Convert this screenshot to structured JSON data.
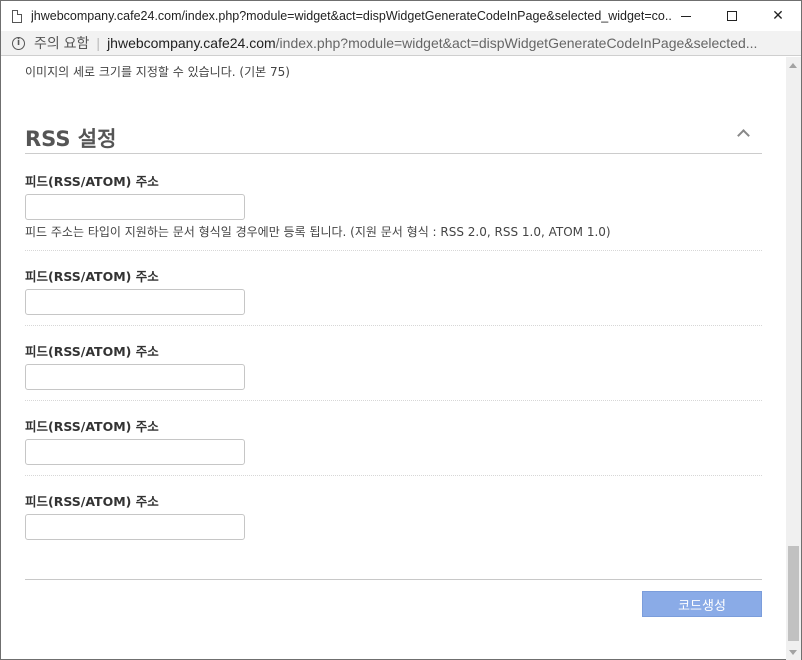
{
  "window": {
    "title": "jhwebcompany.cafe24.com/index.php?module=widget&act=dispWidgetGenerateCodeInPage&selected_widget=co...",
    "controls": {
      "minimize": "",
      "maximize": "",
      "close": "✕"
    }
  },
  "addressbar": {
    "info": "i",
    "warning": "주의 요함",
    "separator": "|",
    "host": "jhwebcompany.cafe24.com",
    "path": "/index.php?module=widget&act=dispWidgetGenerateCodeInPage&selected..."
  },
  "content": {
    "top_hint": "이미지의 세로 크기를 지정할 수 있습니다. (기본 75)",
    "section_title": "RSS 설정",
    "fields": [
      {
        "label": "피드(RSS/ATOM) 주소",
        "value": "",
        "help": "피드 주소는 타입이 지원하는 문서 형식일 경우에만 등록 됩니다. (지원 문서 형식 : RSS 2.0, RSS 1.0, ATOM 1.0)"
      },
      {
        "label": "피드(RSS/ATOM) 주소",
        "value": ""
      },
      {
        "label": "피드(RSS/ATOM) 주소",
        "value": ""
      },
      {
        "label": "피드(RSS/ATOM) 주소",
        "value": ""
      },
      {
        "label": "피드(RSS/ATOM) 주소",
        "value": ""
      }
    ],
    "generate_button": "코드생성"
  },
  "colors": {
    "button_bg": "#8aabe7",
    "section_title": "#555555"
  }
}
